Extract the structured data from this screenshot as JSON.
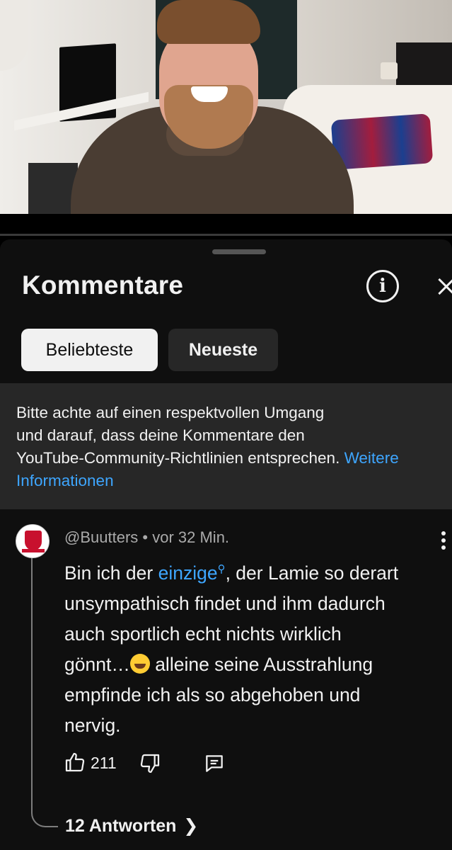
{
  "video": {
    "progress": 0.0
  },
  "panel": {
    "title": "Kommentare",
    "sort": {
      "active": "Beliebteste",
      "inactive": "Neueste"
    }
  },
  "notice": {
    "lines": [
      "Bitte achte auf einen respektvollen Umgang",
      "und darauf, dass deine Kommentare den",
      "YouTube-Community-Richtlinien entsprechen."
    ],
    "link_part1": "Weitere",
    "link_part2": "Informationen"
  },
  "comment": {
    "author": "@Buutters",
    "separator": "•",
    "time": "vor 32 Min.",
    "line1_pre": "Bin ich der ",
    "line1_link": "einzige",
    "line1_post": ", der Lamie so derart",
    "line2": "unsympathisch findet und ihm dadurch",
    "line3": "auch sportlich echt nichts wirklich",
    "line4_pre": "gönnt…",
    "line4_post": " alleine seine Ausstrahlung",
    "line5": "empfinde ich als so abgehoben und",
    "line6": "nervig.",
    "likes": "211",
    "replies": "12 Antworten"
  },
  "colors": {
    "link": "#3ea6ff",
    "background": "#0f0f0f",
    "notice_bg": "#272727"
  }
}
